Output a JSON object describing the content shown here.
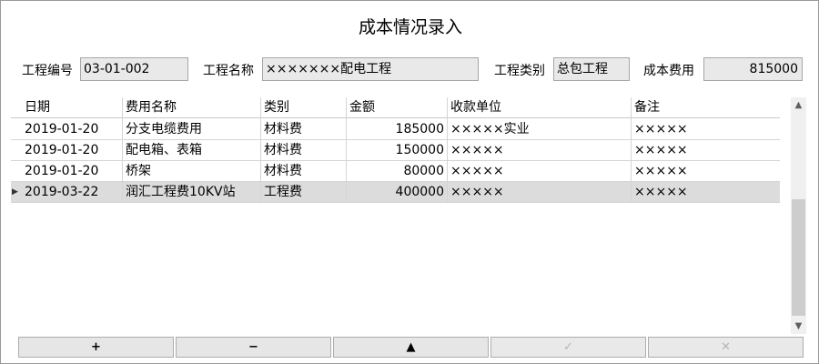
{
  "window": {
    "title": "成本情况录入"
  },
  "form": {
    "project_no_label": "工程编号",
    "project_no": "03-01-002",
    "project_name_label": "工程名称",
    "project_name": "×××××××配电工程",
    "project_type_label": "工程类别",
    "project_type": "总包工程",
    "cost_label": "成本费用",
    "cost": "815000"
  },
  "table": {
    "columns": [
      "日期",
      "费用名称",
      "类别",
      "金额",
      "收款单位",
      "备注"
    ],
    "rows": [
      {
        "date": "2019-01-20",
        "name": "分支电缆费用",
        "category": "材料费",
        "amount": "185000",
        "payee": "×××××实业",
        "note": "×××××"
      },
      {
        "date": "2019-01-20",
        "name": "配电箱、表箱",
        "category": "材料费",
        "amount": "150000",
        "payee": "×××××",
        "note": "×××××"
      },
      {
        "date": "2019-01-20",
        "name": "桥架",
        "category": "材料费",
        "amount": "80000",
        "payee": "×××××",
        "note": "×××××"
      },
      {
        "date": "2019-03-22",
        "name": "润汇工程费10KV站",
        "category": "工程费",
        "amount": "400000",
        "payee": "×××××",
        "note": "×××××"
      }
    ],
    "current_row_marker": "▶"
  },
  "scrollbar": {
    "up": "▲",
    "down": "▼"
  },
  "toolbar": {
    "add": "+",
    "delete": "−",
    "up": "▲",
    "confirm": "✓",
    "cancel": "✕"
  },
  "icons": {
    "confirm": "check-icon",
    "cancel": "close-icon"
  }
}
